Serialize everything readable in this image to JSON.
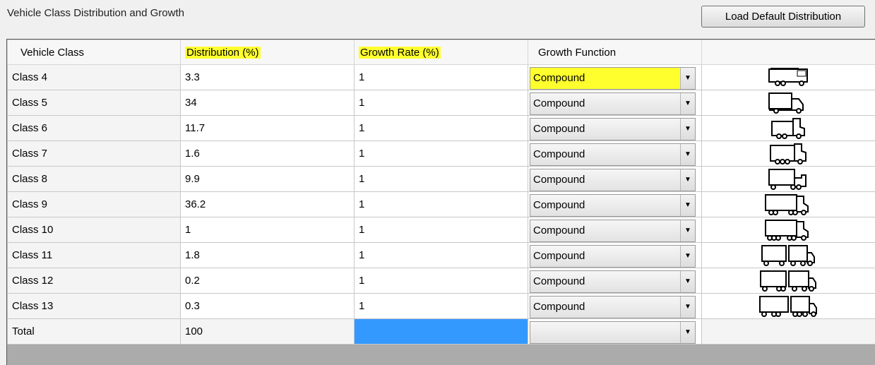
{
  "section_title": "Vehicle Class Distribution and Growth",
  "load_button_label": "Load Default Distribution",
  "columns": [
    "Vehicle Class",
    "Distribution (%)",
    "Growth Rate (%)",
    "Growth Function",
    ""
  ],
  "rows": [
    {
      "cls": "Class 4",
      "dist": "3.3",
      "rate": "1",
      "func": "Compound",
      "icon": "bus-icon"
    },
    {
      "cls": "Class 5",
      "dist": "34",
      "rate": "1",
      "func": "Compound",
      "icon": "two-axle-truck-icon"
    },
    {
      "cls": "Class 6",
      "dist": "11.7",
      "rate": "1",
      "func": "Compound",
      "icon": "three-axle-truck-icon"
    },
    {
      "cls": "Class 7",
      "dist": "1.6",
      "rate": "1",
      "func": "Compound",
      "icon": "four-axle-truck-icon"
    },
    {
      "cls": "Class 8",
      "dist": "9.9",
      "rate": "1",
      "func": "Compound",
      "icon": "small-tractor-trailer-icon"
    },
    {
      "cls": "Class 9",
      "dist": "36.2",
      "rate": "1",
      "func": "Compound",
      "icon": "five-axle-tractor-trailer-icon"
    },
    {
      "cls": "Class 10",
      "dist": "1",
      "rate": "1",
      "func": "Compound",
      "icon": "six-axle-tractor-trailer-icon"
    },
    {
      "cls": "Class 11",
      "dist": "1.8",
      "rate": "1",
      "func": "Compound",
      "icon": "double-trailer-icon"
    },
    {
      "cls": "Class 12",
      "dist": "0.2",
      "rate": "1",
      "func": "Compound",
      "icon": "six-axle-double-trailer-icon"
    },
    {
      "cls": "Class 13",
      "dist": "0.3",
      "rate": "1",
      "func": "Compound",
      "icon": "multi-trailer-icon"
    }
  ],
  "total": {
    "cls": "Total",
    "dist": "100",
    "rate": "",
    "func": ""
  },
  "colors": {
    "highlight": "#ffff2e",
    "selected_cell": "#3399ff"
  }
}
